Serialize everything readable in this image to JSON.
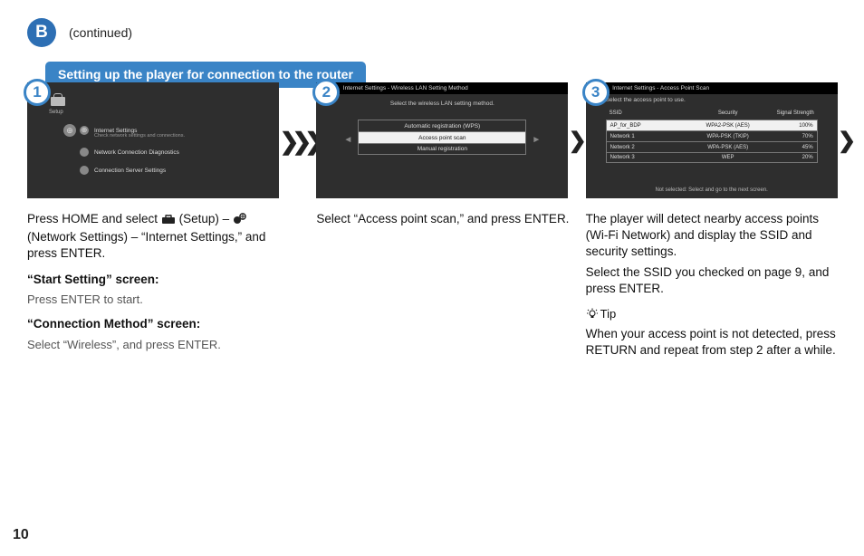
{
  "page_number": "10",
  "section_letter": "B",
  "continued": "(continued)",
  "banner": "Setting up the player for connection to the router",
  "steps": {
    "s1": {
      "num": "1",
      "mock": {
        "setup": "Setup",
        "row1": "Internet Settings",
        "row1b": "Check network settings and connections.",
        "row2": "Network Connection Diagnostics",
        "row3": "Connection Server Settings"
      },
      "body": {
        "p1a": "Press HOME and select ",
        "p1b": " (Setup) – ",
        "p1c": " (Network Settings) – “Internet Settings,” and press ENTER.",
        "h1": "“Start Setting” screen:",
        "sub1": "Press ENTER to start.",
        "h2": "“Connection Method” screen:",
        "sub2": "Select “Wireless”, and press ENTER."
      }
    },
    "s2": {
      "num": "2",
      "mock": {
        "title": "Internet Settings - Wireless LAN Setting Method",
        "subtitle": "Select the wireless LAN setting method.",
        "row1": "Automatic registration (WPS)",
        "row2": "Access point scan",
        "row3": "Manual registration"
      },
      "body": {
        "p1": "Select “Access point scan,” and press ENTER."
      }
    },
    "s3": {
      "num": "3",
      "mock": {
        "title": "Internet Settings - Access Point Scan",
        "note": "Select the access point to use.",
        "hdr": {
          "c1": "SSID",
          "c2": "Security",
          "c3": "Signal Strength"
        },
        "rows": [
          {
            "c1": "AP_for_BDP",
            "c2": "WPA2-PSK (AES)",
            "c3": "100%"
          },
          {
            "c1": "Network 1",
            "c2": "WPA-PSK (TKIP)",
            "c3": "70%"
          },
          {
            "c1": "Network 2",
            "c2": "WPA-PSK (AES)",
            "c3": "45%"
          },
          {
            "c1": "Network 3",
            "c2": "WEP",
            "c3": "20%"
          }
        ],
        "foot": "Not selected: Select and go to the next screen."
      },
      "body": {
        "p1": "The player will detect nearby access points (Wi-Fi Network) and display the SSID and security settings.",
        "p2": "Select the SSID you checked on page 9, and press ENTER.",
        "tip_label": "Tip",
        "tip": "When your access point is not detected, press RETURN and repeat from step 2 after a while."
      }
    }
  }
}
